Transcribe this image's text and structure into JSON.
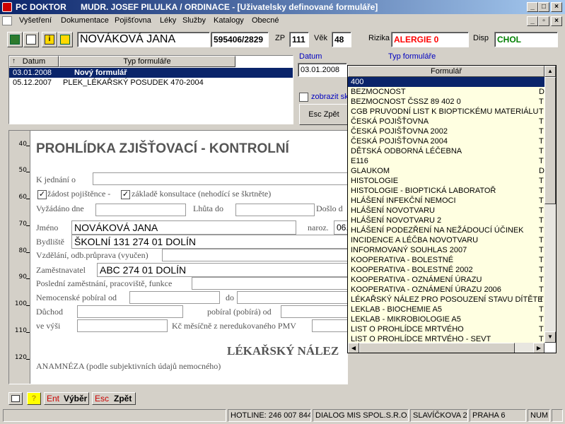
{
  "window": {
    "app_name": "PC DOKTOR",
    "title": "MUDR. JOSEF PILULKA / ORDINACE - [Uživatelsky definované formuláře]"
  },
  "menu": [
    "Vyšetření",
    "Dokumentace",
    "Pojišťovna",
    "Léky",
    "Služby",
    "Katalogy",
    "Obecné"
  ],
  "patient": {
    "name": "NOVÁKOVÁ JANA",
    "birth_number": "595406/2829",
    "zp_label": "ZP",
    "zp": "111",
    "age_label": "Věk",
    "age": "48",
    "risk_label": "Rizika",
    "risk": "ALERGIE 0",
    "disp_label": "Disp",
    "disp": "CHOL"
  },
  "colors": {
    "accent": "#0a246a",
    "risk": "#ff0000",
    "disp": "#008000",
    "dropdown_bg": "#ffffe1"
  },
  "records": {
    "headers": [
      "Datum",
      "Typ formuláře"
    ],
    "rows": [
      {
        "date": "03.01.2008",
        "type": "Nový formulář",
        "selected": true
      },
      {
        "date": "05.12.2007",
        "type": "PLEK_LÉKAŘSKÝ POSUDEK 470-2004",
        "selected": false
      }
    ]
  },
  "filter": {
    "date_label": "Datum",
    "type_label": "Typ formuláře",
    "date_value": "03.01.2008",
    "show_label": "zobrazit sk",
    "back_button": "Esc Zpět"
  },
  "form": {
    "title": "PROHLÍDKA ZJIŠŤOVACÍ - KONTROLNÍ",
    "ruler": [
      "40",
      "50",
      "60",
      "70",
      "80",
      "90",
      "100",
      "110",
      "120"
    ],
    "k_jednani": "K jednání o",
    "zadost": "žádost pojištěnce -",
    "zaklade": "základě konsultace (nehodící se škrtněte)",
    "vyzadano": "Vyžádáno dne",
    "lhuta": "Lhůta do",
    "doslo": "Došlo d",
    "jmeno_label": "Jméno",
    "jmeno_value": "NOVÁKOVÁ JANA",
    "naroz_label": "naroz.",
    "naroz_value": "06.",
    "bydliste_label": "Bydliště",
    "bydliste_value": "ŠKOLNÍ 131  274 01 DOLÍN",
    "vzdelani": "Vzdělání, odb.průprava (vyučen)",
    "zamestnavatel_label": "Zaměstnavatel",
    "zamestnavatel_value": "ABC   274 01 DOLÍN",
    "posledni": "Poslední zaměstnání, pracoviště, funkce",
    "nemocenske": "Nemocenské pobíral od",
    "do": "do",
    "duchod": "Důchod",
    "pobiral": "pobíral (pobírá) od",
    "ve_vysi": "ve výši",
    "kc": "Kč měsíčně z neredukovaného PMV",
    "nalez": "LÉKAŘSKÝ NÁLEZ",
    "anamneza": "ANAMNÉZA (podle subjektivních údajů nemocného)"
  },
  "dropdown": {
    "header": "Formulář",
    "items": [
      {
        "name": "400",
        "flag": "",
        "selected": true
      },
      {
        "name": "BEZMOCNOST",
        "flag": "D"
      },
      {
        "name": "BEZMOCNOST ČSSZ 89 402 0",
        "flag": "T"
      },
      {
        "name": "CGB PRUVODNÍ LIST K BIOPTICKÉMU MATERIÁLU",
        "flag": "T"
      },
      {
        "name": "ČESKÁ POJIŠŤOVNA",
        "flag": "T"
      },
      {
        "name": "ČESKÁ POJIŠŤOVNA 2002",
        "flag": "T"
      },
      {
        "name": "ČESKÁ POJIŠŤOVNA 2004",
        "flag": "T"
      },
      {
        "name": "DĚTSKÁ ODBORNÁ LÉČEBNA",
        "flag": "T"
      },
      {
        "name": "E116",
        "flag": "T"
      },
      {
        "name": "GLAUKOM",
        "flag": "D"
      },
      {
        "name": "HISTOLOGIE",
        "flag": "T"
      },
      {
        "name": "HISTOLOGIE - BIOPTICKÁ LABORATOŘ",
        "flag": "T"
      },
      {
        "name": "HLÁŠENÍ INFEKČNÍ NEMOCI",
        "flag": "T"
      },
      {
        "name": "HLÁŠENÍ NOVOTVARU",
        "flag": "T"
      },
      {
        "name": "HLÁŠENÍ NOVOTVARU 2",
        "flag": "T"
      },
      {
        "name": "HLÁŠENÍ PODEZŘENÍ NA NEŽÁDOUCÍ ÚČINEK",
        "flag": "T"
      },
      {
        "name": "INCIDENCE A LÉČBA NOVOTVARU",
        "flag": "T"
      },
      {
        "name": "INFORMOVANÝ SOUHLAS 2007",
        "flag": "T"
      },
      {
        "name": "KOOPERATIVA - BOLESTNÉ",
        "flag": "T"
      },
      {
        "name": "KOOPERATIVA - BOLESTNÉ 2002",
        "flag": "T"
      },
      {
        "name": "KOOPERATIVA - OZNÁMENÍ ÚRAZU",
        "flag": "T"
      },
      {
        "name": "KOOPERATIVA - OZNÁMENÍ ÚRAZU 2006",
        "flag": "T"
      },
      {
        "name": "LÉKAŘSKÝ NÁLEZ PRO POSOUZENÍ STAVU DÍTĚTE",
        "flag": "T"
      },
      {
        "name": "LEKLAB - BIOCHEMIE A5",
        "flag": "T"
      },
      {
        "name": "LEKLAB - MIKROBIOLOGIE A5",
        "flag": "T"
      },
      {
        "name": "LIST O PROHLÍDCE MRTVÉHO",
        "flag": "T"
      },
      {
        "name": "LIST O PROHLÍDCE MRTVÉHO - SEVT",
        "flag": "T"
      }
    ]
  },
  "bottombar": {
    "ent": "Ent",
    "vyber": "Výběr",
    "esc": "Esc",
    "zpet": "Zpět"
  },
  "status": {
    "hotline": "HOTLINE: 246 007 844",
    "company": "DIALOG MIS SPOL.S.R.O.",
    "street": "SLAVÍČKOVA 2",
    "city": "PRAHA 6",
    "num": "NUM"
  }
}
